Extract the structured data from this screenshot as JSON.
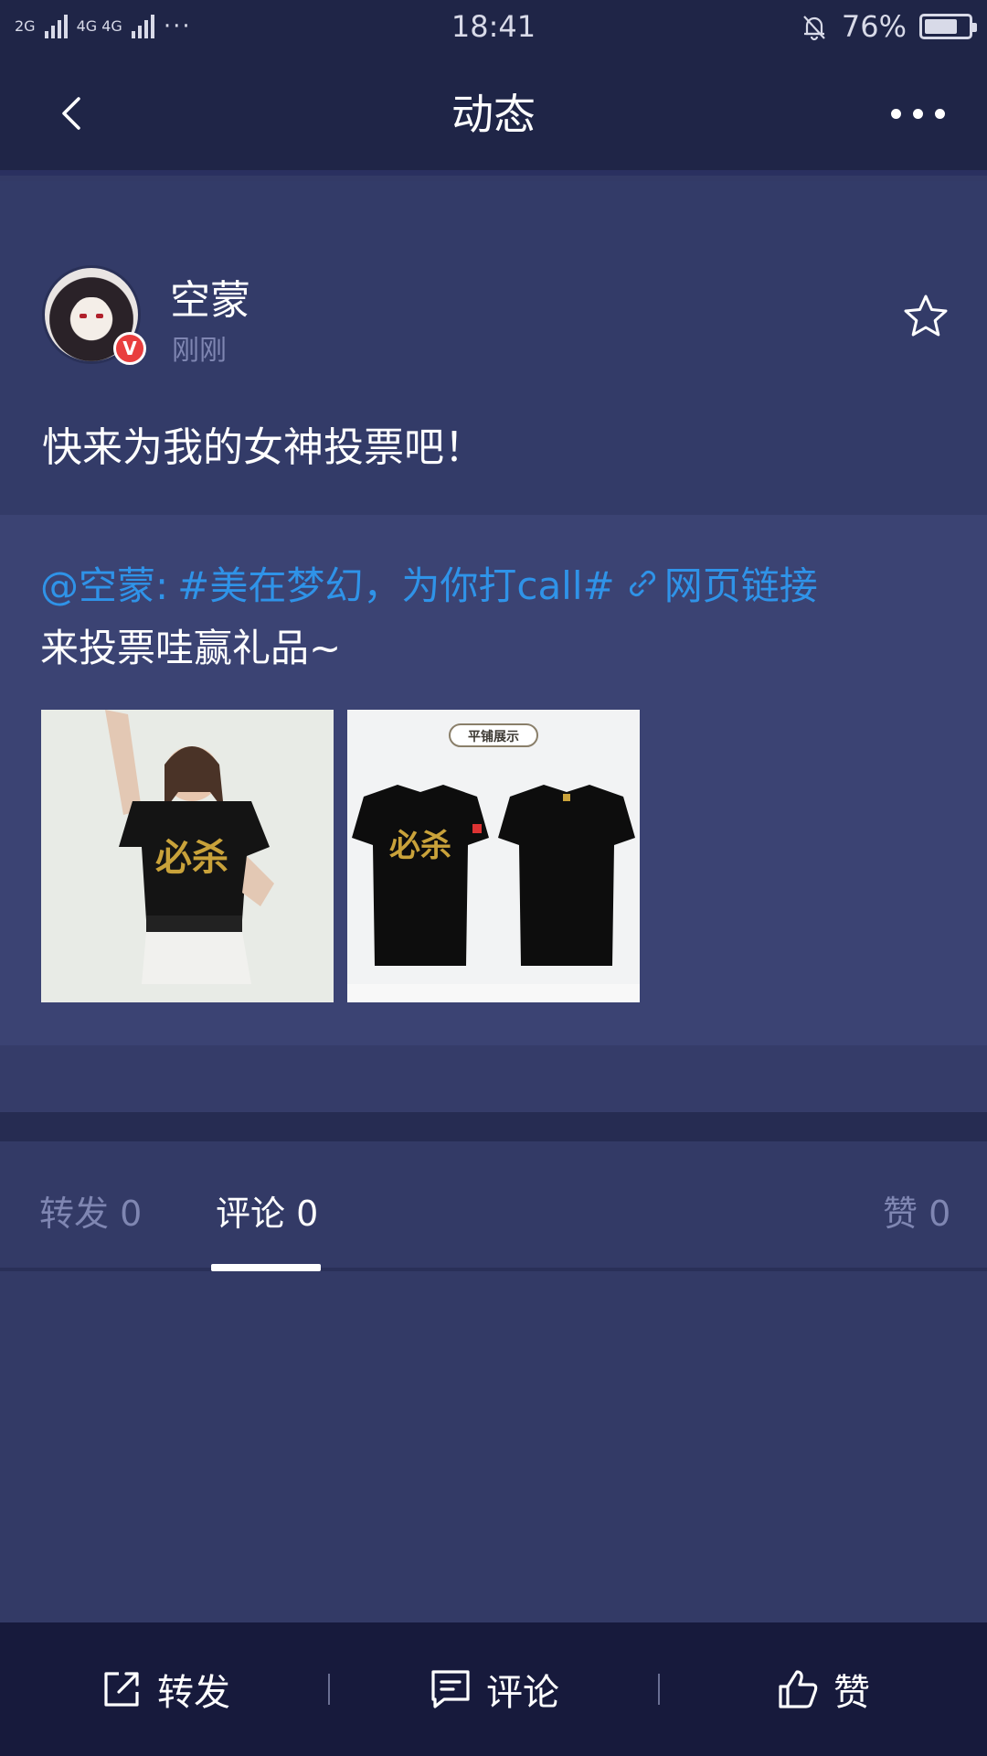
{
  "status_bar": {
    "network_left": "2G",
    "network_right": "4G 4G",
    "more": "···",
    "time": "18:41",
    "battery": "76%",
    "battery_level": 0.76
  },
  "nav": {
    "title": "动态",
    "back_icon": "chevron-left-icon",
    "more_icon": "more-dots-icon"
  },
  "post": {
    "username": "空蒙",
    "timestamp": "刚刚",
    "text": "快来为我的女神投票吧！",
    "verified_icon": "V"
  },
  "repost": {
    "mention": "@空蒙:",
    "topic": "#美在梦幻，为你打call#",
    "link_label": "网页链接",
    "text": "来投票哇赢礼品~",
    "images": [
      "photo-model-black-tee",
      "photo-tshirt-flat-display"
    ],
    "thumb2_tag": "平铺展示"
  },
  "tabs": [
    {
      "label": "转发",
      "count": "0"
    },
    {
      "label": "评论",
      "count": "0"
    },
    {
      "label": "赞",
      "count": "0"
    }
  ],
  "bottom_actions": {
    "forward": "转发",
    "comment": "评论",
    "like": "赞"
  },
  "colors": {
    "nav_bg": "#1f2547",
    "page_bg": "#333a66",
    "link": "#2f93e8",
    "bottom_bar": "#171a3c",
    "badge": "#e93e3e"
  }
}
